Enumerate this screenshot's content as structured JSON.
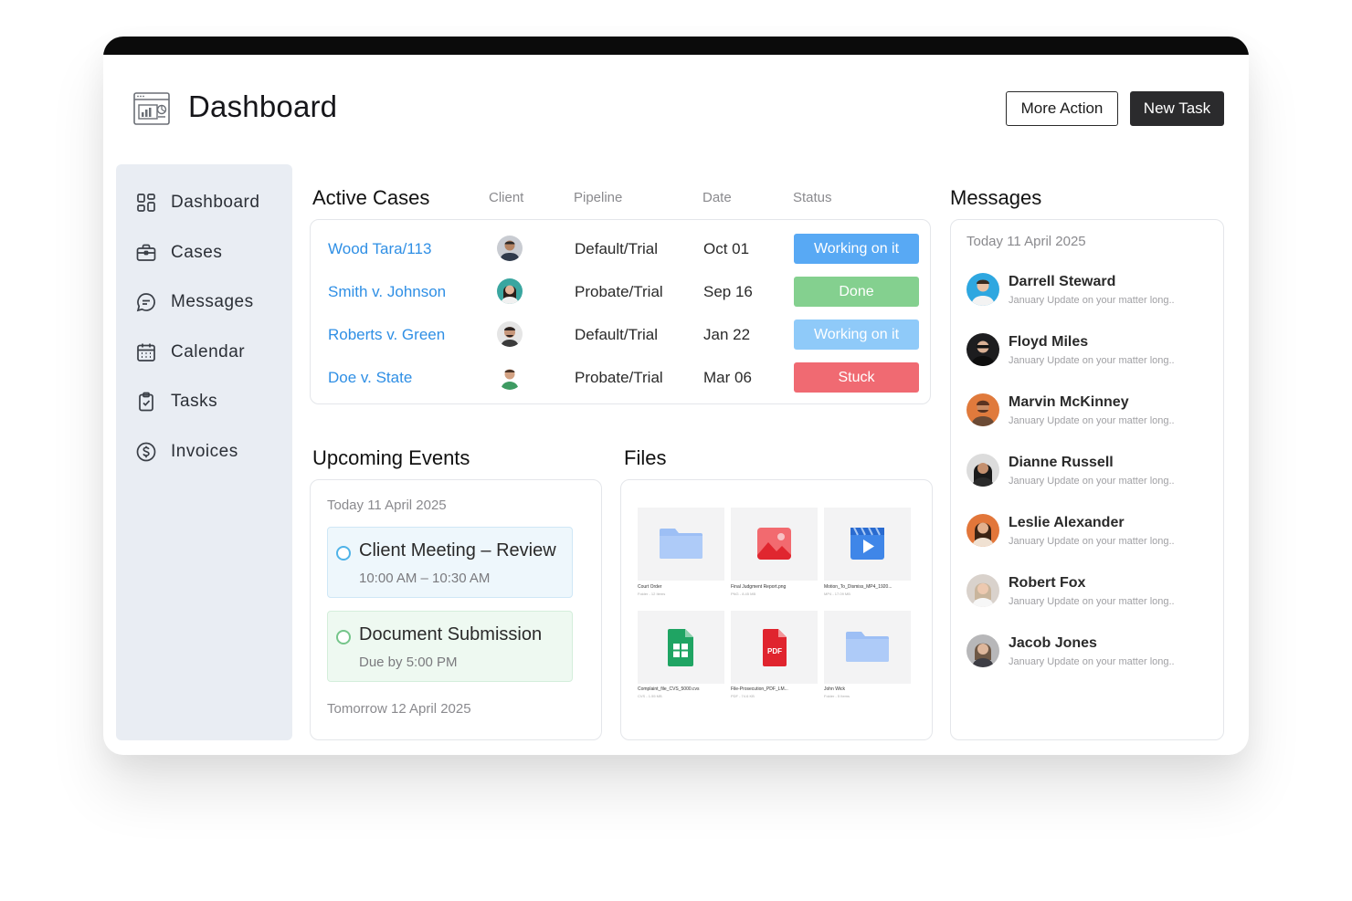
{
  "header": {
    "title": "Dashboard",
    "more_action": "More Action",
    "new_task": "New Task"
  },
  "sidebar": {
    "items": [
      {
        "label": "Dashboard",
        "icon": "grid-icon"
      },
      {
        "label": "Cases",
        "icon": "briefcase-icon"
      },
      {
        "label": "Messages",
        "icon": "chat-icon"
      },
      {
        "label": "Calendar",
        "icon": "calendar-icon"
      },
      {
        "label": "Tasks",
        "icon": "clipboard-check-icon"
      },
      {
        "label": "Invoices",
        "icon": "dollar-icon"
      }
    ]
  },
  "cases": {
    "title": "Active Cases",
    "columns": [
      "Client",
      "Pipeline",
      "Date",
      "Status"
    ],
    "rows": [
      {
        "name": "Wood Tara/113",
        "pipeline": "Default/Trial",
        "date": "Oct 01",
        "status": "Working on it",
        "status_color": "#58a9f4"
      },
      {
        "name": "Smith v. Johnson",
        "pipeline": "Probate/Trial",
        "date": "Sep 16",
        "status": "Done",
        "status_color": "#84d08f"
      },
      {
        "name": "Roberts v. Green",
        "pipeline": "Default/Trial",
        "date": "Jan 22",
        "status": "Working on it",
        "status_color": "#8fcaf9"
      },
      {
        "name": "Doe v. State",
        "pipeline": "Probate/Trial",
        "date": "Mar 06",
        "status": "Stuck",
        "status_color": "#f06a72"
      }
    ]
  },
  "events": {
    "title": "Upcoming Events",
    "today": "Today 11 April 2025",
    "items": [
      {
        "title": "Client Meeting – Review",
        "subtitle": "10:00 AM – 10:30 AM"
      },
      {
        "title": "Document Submission",
        "subtitle": "Due by 5:00 PM"
      }
    ],
    "tomorrow": "Tomorrow 12 April 2025"
  },
  "files": {
    "title": "Files",
    "items": [
      {
        "name": "Court Order",
        "meta": "Folder - 12 Items",
        "icon": "folder-icon"
      },
      {
        "name": "Final Judgment Report.png",
        "meta": "PNG - 8.45 MB",
        "icon": "image-file-icon"
      },
      {
        "name": "Motion_To_Dismiss_MP4_1920...",
        "meta": "MP4 - 17.09 MB",
        "icon": "video-file-icon"
      },
      {
        "name": "Complaint_file_CVS_5000.cvs",
        "meta": "CVS - 1.55 MB",
        "icon": "spreadsheet-file-icon"
      },
      {
        "name": "File-Prosecution_PDF_LM...",
        "meta": "PDF - 74.6 KB",
        "icon": "pdf-file-icon"
      },
      {
        "name": "John Wick",
        "meta": "Folder - 5 Items",
        "icon": "folder-icon"
      }
    ],
    "pdf_badge": "PDF"
  },
  "messages": {
    "title": "Messages",
    "date": "Today 11 April 2025",
    "items": [
      {
        "name": "Darrell Steward",
        "preview": "January Update on your matter long.."
      },
      {
        "name": "Floyd Miles",
        "preview": "January Update on your matter long.."
      },
      {
        "name": "Marvin McKinney",
        "preview": "January Update on your matter long.."
      },
      {
        "name": "Dianne Russell",
        "preview": "January Update on your matter long.."
      },
      {
        "name": "Leslie Alexander",
        "preview": "January Update on your matter long.."
      },
      {
        "name": "Robert Fox",
        "preview": "January Update on your matter long.."
      },
      {
        "name": "Jacob Jones",
        "preview": "January Update on your matter long.."
      }
    ]
  }
}
